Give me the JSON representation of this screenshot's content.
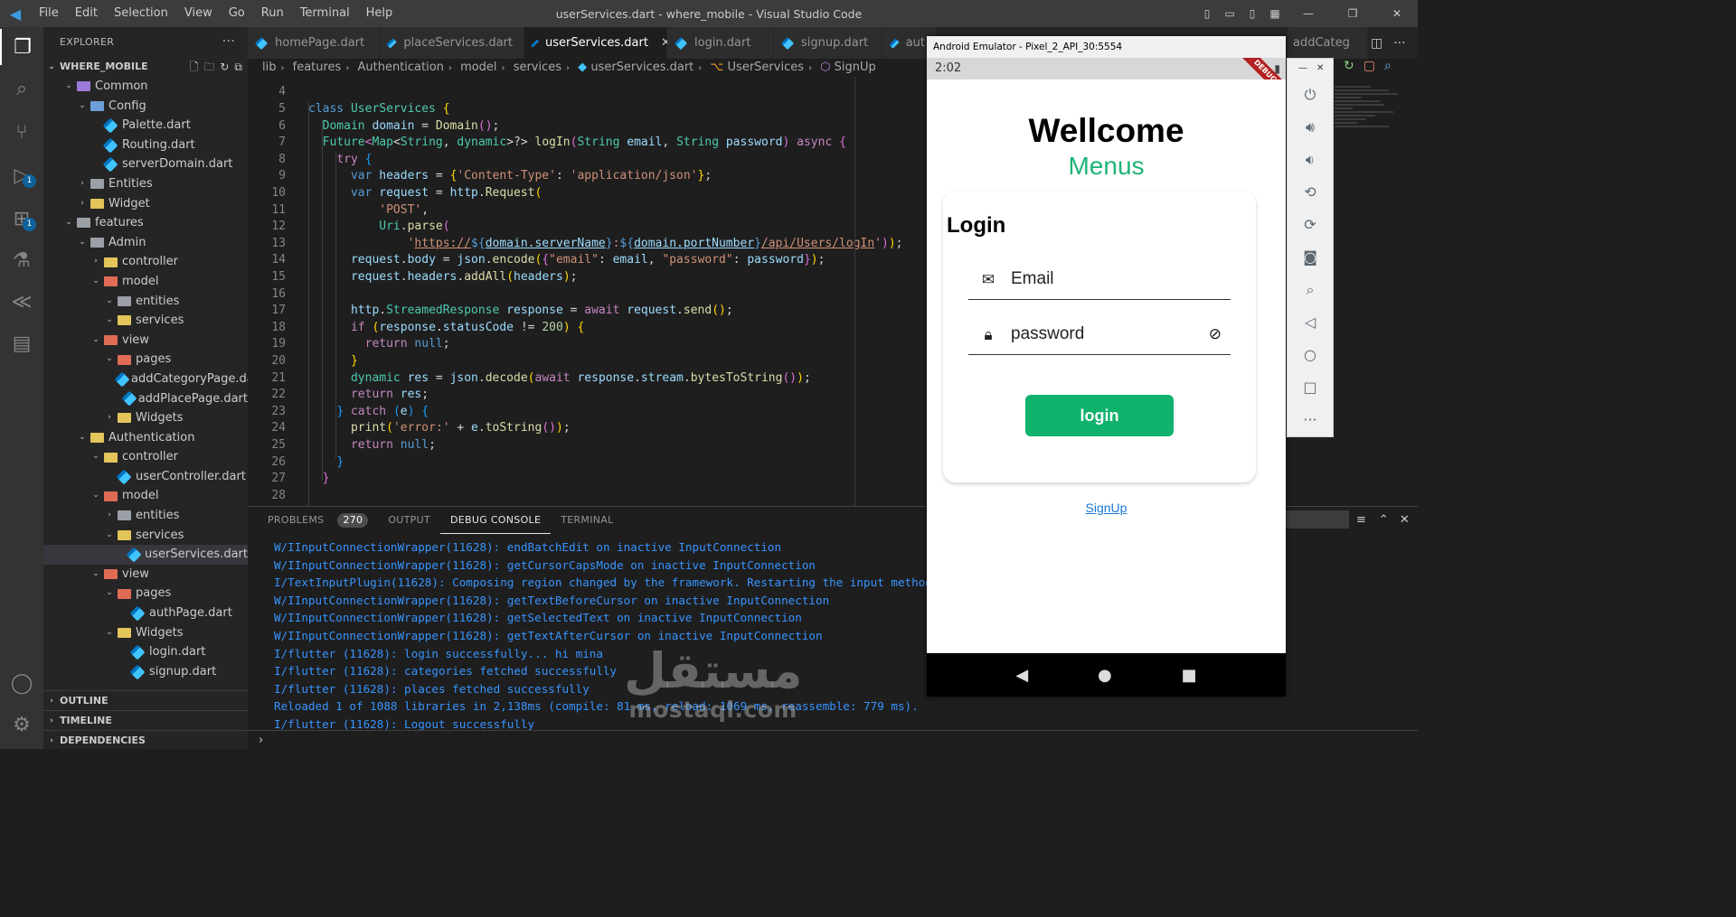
{
  "titlebar": {
    "menu": [
      "File",
      "Edit",
      "Selection",
      "View",
      "Go",
      "Run",
      "Terminal",
      "Help"
    ],
    "title": "userServices.dart - where_mobile - Visual Studio Code"
  },
  "activity": {
    "badges": [
      "1",
      "1"
    ]
  },
  "explorer": {
    "header": "EXPLORER",
    "root": "WHERE_MOBILE",
    "items": [
      {
        "label": "Common",
        "depth": 1,
        "chev": "⌄",
        "folder": "purple"
      },
      {
        "label": "Config",
        "depth": 2,
        "chev": "⌄",
        "folder": "blue"
      },
      {
        "label": "Palette.dart",
        "depth": 3,
        "file": true
      },
      {
        "label": "Routing.dart",
        "depth": 3,
        "file": true
      },
      {
        "label": "serverDomain.dart",
        "depth": 3,
        "file": true
      },
      {
        "label": "Entities",
        "depth": 2,
        "chev": "›",
        "folder": "gray"
      },
      {
        "label": "Widget",
        "depth": 2,
        "chev": "›",
        "folder": "yel"
      },
      {
        "label": "features",
        "depth": 1,
        "chev": "⌄",
        "folder": "gray"
      },
      {
        "label": "Admin",
        "depth": 2,
        "chev": "⌄",
        "folder": "gray"
      },
      {
        "label": "controller",
        "depth": 3,
        "chev": "›",
        "folder": "yel"
      },
      {
        "label": "model",
        "depth": 3,
        "chev": "⌄",
        "folder": "red"
      },
      {
        "label": "entities",
        "depth": 4,
        "chev": "⌄",
        "folder": "gray"
      },
      {
        "label": "services",
        "depth": 4,
        "chev": "⌄",
        "folder": "yel"
      },
      {
        "label": "view",
        "depth": 3,
        "chev": "⌄",
        "folder": "red"
      },
      {
        "label": "pages",
        "depth": 4,
        "chev": "⌄",
        "folder": "red"
      },
      {
        "label": "addCategoryPage.dart",
        "depth": 5,
        "file": true
      },
      {
        "label": "addPlacePage.dart",
        "depth": 5,
        "file": true
      },
      {
        "label": "Widgets",
        "depth": 4,
        "chev": "›",
        "folder": "yel"
      },
      {
        "label": "Authentication",
        "depth": 2,
        "chev": "⌄",
        "folder": "yel"
      },
      {
        "label": "controller",
        "depth": 3,
        "chev": "⌄",
        "folder": "yel"
      },
      {
        "label": "userController.dart",
        "depth": 4,
        "file": true
      },
      {
        "label": "model",
        "depth": 3,
        "chev": "⌄",
        "folder": "red"
      },
      {
        "label": "entities",
        "depth": 4,
        "chev": "›",
        "folder": "gray"
      },
      {
        "label": "services",
        "depth": 4,
        "chev": "⌄",
        "folder": "yel"
      },
      {
        "label": "userServices.dart",
        "depth": 5,
        "file": true,
        "selected": true
      },
      {
        "label": "view",
        "depth": 3,
        "chev": "⌄",
        "folder": "red"
      },
      {
        "label": "pages",
        "depth": 4,
        "chev": "⌄",
        "folder": "red"
      },
      {
        "label": "authPage.dart",
        "depth": 5,
        "file": true
      },
      {
        "label": "Widgets",
        "depth": 4,
        "chev": "⌄",
        "folder": "yel"
      },
      {
        "label": "login.dart",
        "depth": 5,
        "file": true
      },
      {
        "label": "signup.dart",
        "depth": 5,
        "file": true
      }
    ],
    "sections": [
      "OUTLINE",
      "TIMELINE",
      "DEPENDENCIES"
    ]
  },
  "tabs": [
    "homePage.dart",
    "placeServices.dart",
    "userServices.dart",
    "login.dart",
    "signup.dart",
    "aut"
  ],
  "right_tab": "addCateg",
  "breadcrumb": [
    "lib",
    "features",
    "Authentication",
    "model",
    "services",
    "userServices.dart",
    "UserServices",
    "SignUp"
  ],
  "editor": {
    "line_numbers": [
      "4",
      "5",
      "6",
      "7",
      "8",
      "9",
      "10",
      "11",
      "12",
      "13",
      "14",
      "15",
      "16",
      "17",
      "18",
      "19",
      "20",
      "21",
      "22",
      "23",
      "24",
      "25",
      "26",
      "27",
      "28"
    ]
  },
  "panel": {
    "tabs": [
      "PROBLEMS",
      "OUTPUT",
      "DEBUG CONSOLE",
      "TERMINAL"
    ],
    "problem_count": "270",
    "console": [
      "W/IInputConnectionWrapper(11628): endBatchEdit on inactive InputConnection",
      "W/IInputConnectionWrapper(11628): getCursorCapsMode on inactive InputConnection",
      "I/TextInputPlugin(11628): Composing region changed by the framework. Restarting the input method",
      "W/IInputConnectionWrapper(11628): getTextBeforeCursor on inactive InputConnection",
      "W/IInputConnectionWrapper(11628): getSelectedText on inactive InputConnection",
      "W/IInputConnectionWrapper(11628): getTextAfterCursor on inactive InputConnection",
      "I/flutter (11628): login successfully... hi mina",
      "I/flutter (11628): categories fetched successfully",
      "I/flutter (11628): places fetched successfully",
      "Reloaded 1 of 1088 libraries in 2,138ms (compile: 81 ms, reload: 1069 ms, reassemble: 779 ms).",
      "I/flutter (11628): Logout successfully"
    ]
  },
  "emulator": {
    "title": "Android Emulator - Pixel_2_API_30:5554",
    "time": "2:02",
    "debug": "DEBUG",
    "welcome": "Wellcome",
    "menus": "Menus",
    "login_title": "Login",
    "email_placeholder": "Email",
    "password_placeholder": "password",
    "login_button": "login",
    "signup_link": "SignUp"
  },
  "watermark": {
    "arabic": "مستقل",
    "latin": "mostaql.com"
  }
}
